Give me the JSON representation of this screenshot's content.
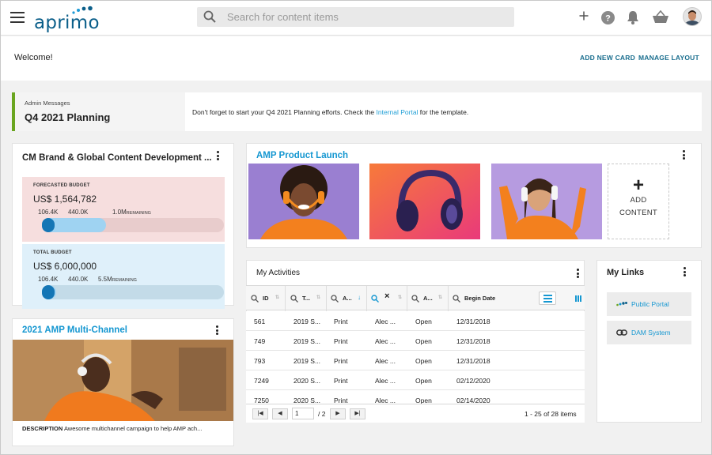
{
  "app": {
    "name": "aprimo"
  },
  "search": {
    "placeholder": "Search for content items"
  },
  "header_icons": [
    "plus-icon",
    "help-icon",
    "bell-icon",
    "basket-icon",
    "avatar"
  ],
  "welcome": {
    "title": "Welcome!",
    "add_card": "ADD NEW CARD",
    "manage_layout": "MANAGE LAYOUT"
  },
  "admin": {
    "label": "Admin Messages",
    "heading": "Q4 2021 Planning",
    "message_before": "Don't forget to start your Q4 2021 Planning efforts. Check the ",
    "link": "Internal Portal",
    "message_after": " for the template."
  },
  "budget_card": {
    "title": "CM Brand & Global Content Development ...",
    "forecasted": {
      "caption": "FORECASTED BUDGET",
      "amount": "US$ 1,564,782",
      "tick1": "106.4K",
      "tick2": "440.0K",
      "remaining": "1.0M",
      "remaining_label": "REMAINING",
      "progress_fraction": 0.35
    },
    "total": {
      "caption": "TOTAL BUDGET",
      "amount": "US$ 6,000,000",
      "tick1": "106.4K",
      "tick2": "440.0K",
      "remaining": "5.5M",
      "remaining_label": "REMAINING",
      "progress_fraction": 0.08
    }
  },
  "multichannel": {
    "title": "2021 AMP Multi-Channel",
    "desc_label": "DESCRIPTION",
    "desc": "Awesome multichannel campaign to help AMP ach..."
  },
  "product_launch": {
    "title": "AMP Product Launch",
    "add_label_1": "ADD",
    "add_label_2": "CONTENT"
  },
  "activities": {
    "title": "My Activities",
    "columns": [
      "ID",
      "T...",
      "A...",
      "",
      "A...",
      "Begin Date"
    ],
    "rows": [
      [
        "561",
        "2019 S...",
        "Print",
        "Alec ...",
        "Open",
        "12/31/2018"
      ],
      [
        "749",
        "2019 S...",
        "Print",
        "Alec ...",
        "Open",
        "12/31/2018"
      ],
      [
        "793",
        "2019 S...",
        "Print",
        "Alec ...",
        "Open",
        "12/31/2018"
      ],
      [
        "7249",
        "2020 S...",
        "Print",
        "Alec ...",
        "Open",
        "02/12/2020"
      ],
      [
        "7250",
        "2020 S...",
        "Print",
        "Alec ...",
        "Open",
        "02/14/2020"
      ]
    ],
    "page_value": "1",
    "page_total": "/ 2",
    "items_summary": "1 - 25 of 28 items"
  },
  "links": {
    "title": "My Links",
    "items": [
      {
        "label": "Public Portal",
        "icon": "dots-icon"
      },
      {
        "label": "DAM System",
        "icon": "link-icon"
      }
    ]
  },
  "colors": {
    "brand": "#0b5f8a",
    "accent": "#1597d1",
    "admin_bar": "#6aa51f",
    "budget_pink": "#f6dede",
    "budget_blue": "#dff0fa",
    "orange": "#f47a20"
  }
}
